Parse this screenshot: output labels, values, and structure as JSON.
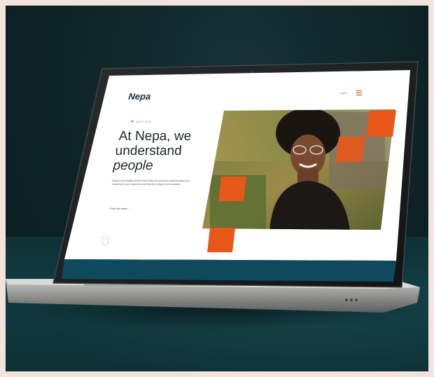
{
  "site": {
    "logo": "Nepa",
    "nav_login": "Login",
    "hero_eyebrow": "ABOUT NEPA",
    "hero_line1": "At Nepa, we",
    "hero_line2": "understand",
    "hero_line3": "people",
    "hero_body": "Nepa is an insights partner that helps you grow by understanding your customers, your channels and how they shape your business.",
    "hero_link": "Find out more →"
  },
  "colors": {
    "accent": "#e8561a",
    "screen_bg": "#ffffff",
    "screen_band": "#0f4a5c",
    "background": "#0e2326",
    "frame": "#f2e4dc"
  },
  "icons": {
    "menu": "hamburger-menu-icon",
    "scroll": "mouse-scroll-icon"
  }
}
